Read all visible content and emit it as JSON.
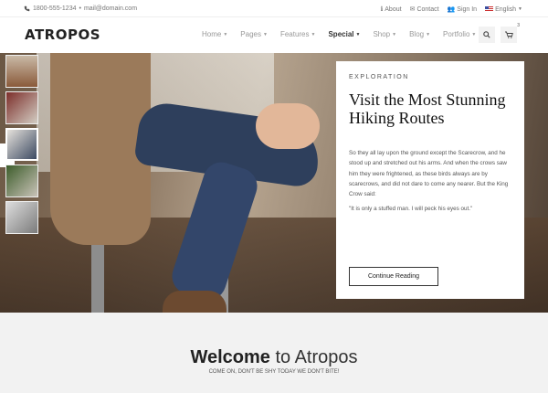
{
  "topbar": {
    "phone": "1800-555-1234",
    "separator": "•",
    "email": "mail@domain.com",
    "links": [
      "About",
      "Contact",
      "Sign In"
    ],
    "language": "English"
  },
  "header": {
    "logo": "ATROPOS",
    "nav": [
      "Home",
      "Pages",
      "Features",
      "Special",
      "Shop",
      "Blog",
      "Portfolio"
    ],
    "active_nav": "Special",
    "cart_count": "3"
  },
  "hero": {
    "eyebrow": "EXPLORATION",
    "title": "Visit the Most Stunning Hiking Routes",
    "body": "So they all lay upon the ground except the Scarecrow, and he stood up and stretched out his arms. And when the crows saw him they were frightened, as these birds always are by scarecrows, and did not dare to come any nearer. But the King Crow said:",
    "quote": "\"It is only a stuffed man. I will peck his eyes out.\"",
    "button": "Continue Reading",
    "side_arrow": "»"
  },
  "welcome": {
    "heading_bold": "Welcome",
    "heading_rest": " to Atropos",
    "sub": "COME ON, DON'T BE SHY TODAY WE DON'T BITE!"
  }
}
